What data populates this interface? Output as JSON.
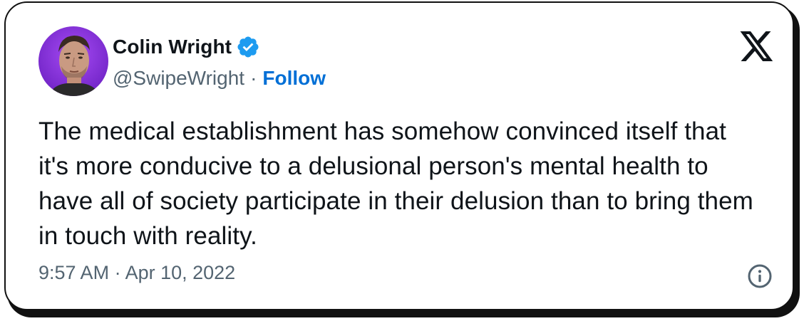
{
  "tweet": {
    "author_name": "Colin Wright",
    "handle": "@SwipeWright",
    "separator": "·",
    "follow_label": "Follow",
    "verified": true,
    "text": "The medical establishment has somehow convinced itself that it's more conducive to a delusional person's mental health to have all of society participate in their delusion than to bring them in touch with reality.",
    "timestamp": "9:57 AM · Apr 10, 2022"
  },
  "icons": {
    "verified": "verified-badge-icon",
    "brand": "x-logo-icon",
    "info": "info-icon"
  },
  "colors": {
    "text_primary": "#0f1419",
    "text_secondary": "#536471",
    "link": "#006fd6",
    "verified_badge": "#1d9bf0",
    "avatar_background": "#8a2be2"
  }
}
